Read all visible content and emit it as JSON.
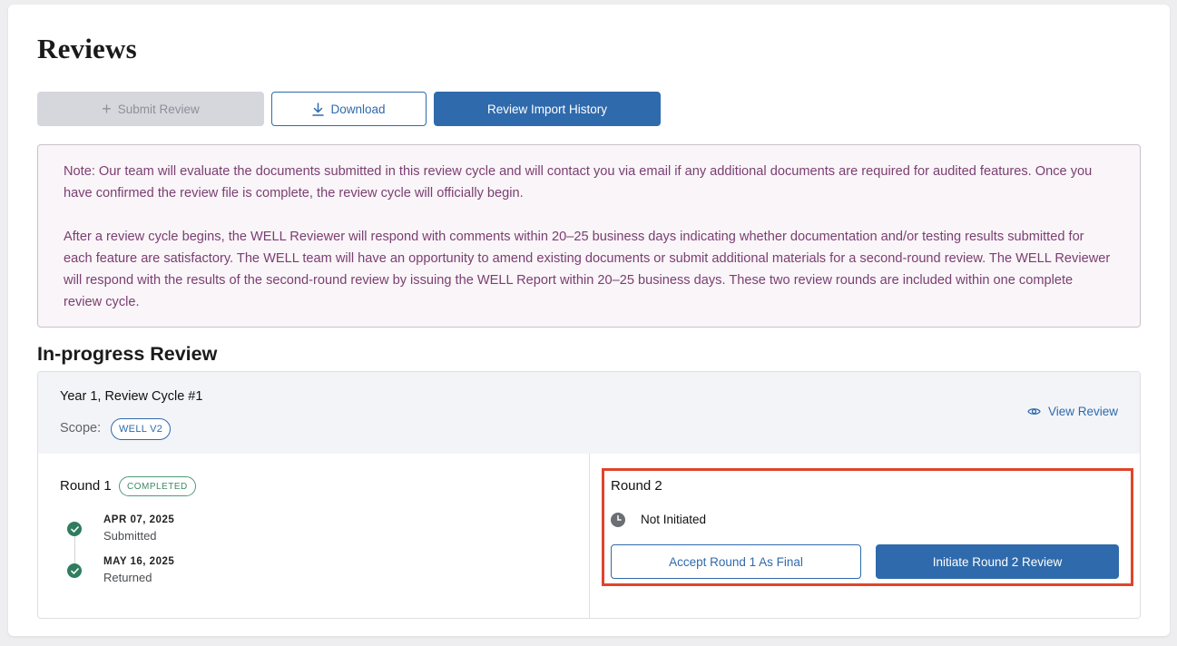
{
  "page": {
    "title": "Reviews"
  },
  "toolbar": {
    "submit_label": "Submit Review",
    "download_label": "Download",
    "history_label": "Review Import History"
  },
  "note": {
    "paragraph1": "Note: Our team will evaluate the documents submitted in this review cycle and will contact you via email if any additional documents are required for audited features. Once you have confirmed the review file is complete, the review cycle will officially begin.",
    "paragraph2": "After a review cycle begins, the WELL Reviewer will respond with comments within 20–25 business days indicating whether documentation and/or testing results submitted for each feature are satisfactory. The WELL team will have an opportunity to amend existing documents or submit additional materials for a second-round review. The WELL Reviewer will respond with the results of the second-round review by issuing the WELL Report within 20–25 business days. These two review rounds are included within one complete review cycle."
  },
  "in_progress": {
    "section_title": "In-progress Review",
    "cycle_title": "Year 1, Review Cycle #1",
    "scope_label": "Scope:",
    "scope_badge": "WELL V2",
    "view_review_label": "View Review",
    "round1": {
      "title": "Round 1",
      "status_badge": "COMPLETED",
      "timeline": [
        {
          "date": "APR 07, 2025",
          "label": "Submitted"
        },
        {
          "date": "MAY 16, 2025",
          "label": "Returned"
        }
      ]
    },
    "round2": {
      "title": "Round 2",
      "status": "Not Initiated",
      "accept_label": "Accept Round 1 As Final",
      "initiate_label": "Initiate Round 2 Review"
    }
  },
  "icons": {
    "submit": "plus-icon",
    "download": "download-icon",
    "view": "eye-icon",
    "status": "clock-icon",
    "timeline": "check-circle-icon"
  },
  "colors": {
    "primary": "#2f6aac",
    "note_text": "#7b3e72",
    "note_bg": "#f9f5f8",
    "success": "#2f7d5e",
    "highlight": "#e0442a",
    "disabled_bg": "#d6d7dd"
  }
}
